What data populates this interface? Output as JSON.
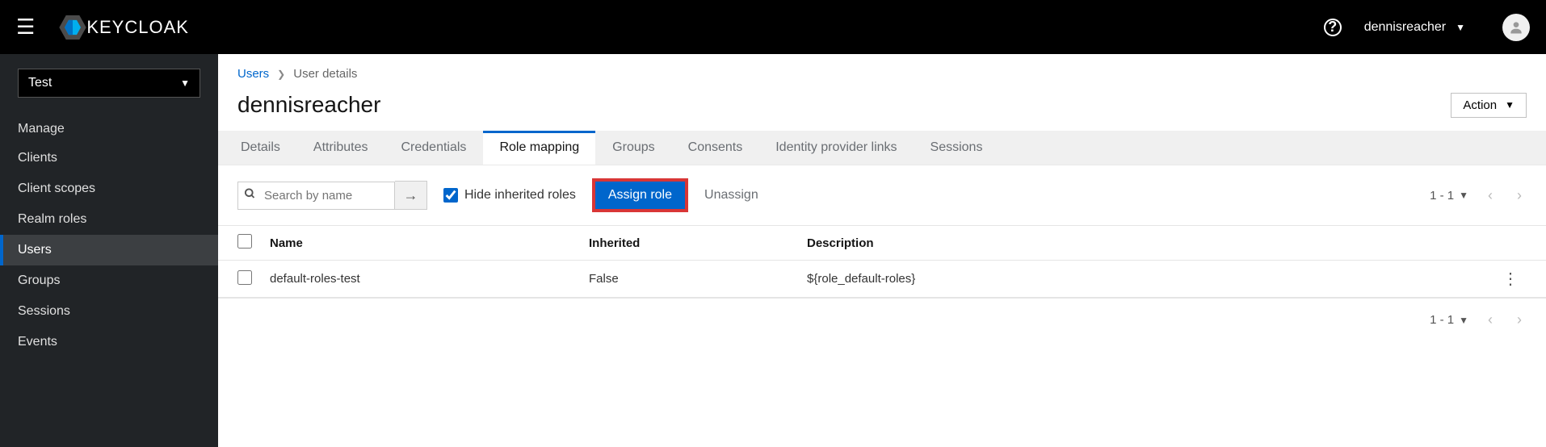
{
  "header": {
    "brand": "KEYCLOAK",
    "username": "dennisreacher"
  },
  "sidebar": {
    "realm": "Test",
    "section_title": "Manage",
    "items": [
      {
        "label": "Clients"
      },
      {
        "label": "Client scopes"
      },
      {
        "label": "Realm roles"
      },
      {
        "label": "Users"
      },
      {
        "label": "Groups"
      },
      {
        "label": "Sessions"
      },
      {
        "label": "Events"
      }
    ]
  },
  "breadcrumb": {
    "root": "Users",
    "current": "User details"
  },
  "page_title": "dennisreacher",
  "action_label": "Action",
  "tabs": [
    {
      "label": "Details"
    },
    {
      "label": "Attributes"
    },
    {
      "label": "Credentials"
    },
    {
      "label": "Role mapping"
    },
    {
      "label": "Groups"
    },
    {
      "label": "Consents"
    },
    {
      "label": "Identity provider links"
    },
    {
      "label": "Sessions"
    }
  ],
  "toolbar": {
    "search_placeholder": "Search by name",
    "hide_inherited_label": "Hide inherited roles",
    "assign_role_label": "Assign role",
    "unassign_label": "Unassign",
    "pager": "1 - 1"
  },
  "table": {
    "headers": {
      "name": "Name",
      "inherited": "Inherited",
      "description": "Description"
    },
    "rows": [
      {
        "name": "default-roles-test",
        "inherited": "False",
        "description": "${role_default-roles}"
      }
    ]
  }
}
